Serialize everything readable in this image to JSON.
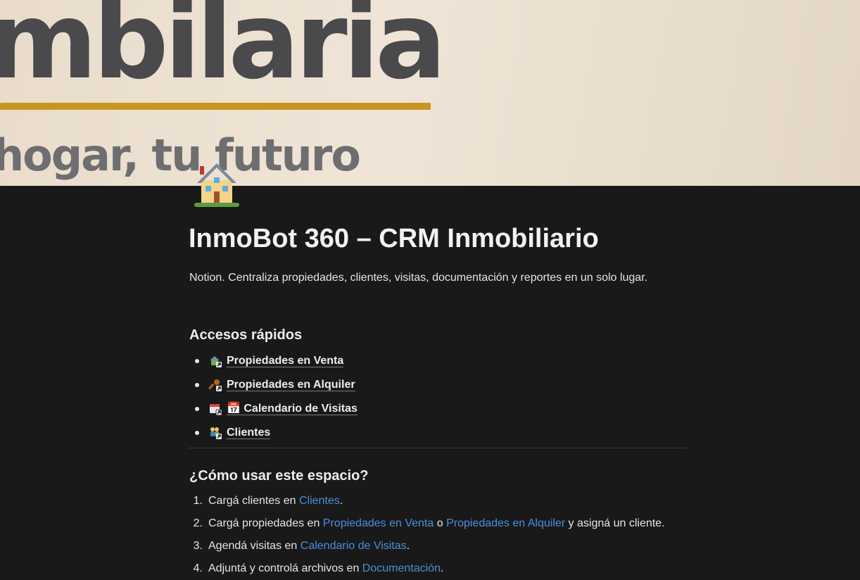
{
  "cover": {
    "word": "mbilaria",
    "tagline": "hogar, tu futuro",
    "colors": {
      "text": "#4a4a4c",
      "bar": "#c8961e",
      "tagline": "#6e6e70"
    }
  },
  "page": {
    "icon": "house-icon",
    "title": "InmoBot 360 – CRM Inmobiliario",
    "description": "Notion. Centraliza propiedades, clientes, visitas, documentación y reportes en un solo lugar."
  },
  "quick_access": {
    "heading": "Accesos rápidos",
    "items": [
      {
        "icon": "house-link-icon",
        "label": "Propiedades en Venta"
      },
      {
        "icon": "key-link-icon",
        "label": "Propiedades en Alquiler"
      },
      {
        "icon": "calendar-link-icon",
        "label": "📅 Calendario de Visitas"
      },
      {
        "icon": "people-link-icon",
        "label": "Clientes"
      }
    ]
  },
  "howto": {
    "heading": "¿Cómo usar este espacio?",
    "steps": [
      {
        "num": "1.",
        "pre": "Cargá clientes en ",
        "link1": "Clientes",
        "mid": ".",
        "link2": "",
        "post": ""
      },
      {
        "num": "2.",
        "pre": "Cargá propiedades en ",
        "link1": "Propiedades en Venta",
        "mid": " o ",
        "link2": "Propiedades en Alquiler",
        "post": " y asigná un cliente."
      },
      {
        "num": "3.",
        "pre": "Agendá visitas en ",
        "link1": "Calendario de Visitas",
        "mid": ".",
        "link2": "",
        "post": ""
      },
      {
        "num": "4.",
        "pre": "Adjuntá y controlá archivos en ",
        "link1": "Documentación",
        "mid": ".",
        "link2": "",
        "post": ""
      }
    ]
  },
  "colors": {
    "background": "#191919",
    "link": "#4a90d9"
  }
}
